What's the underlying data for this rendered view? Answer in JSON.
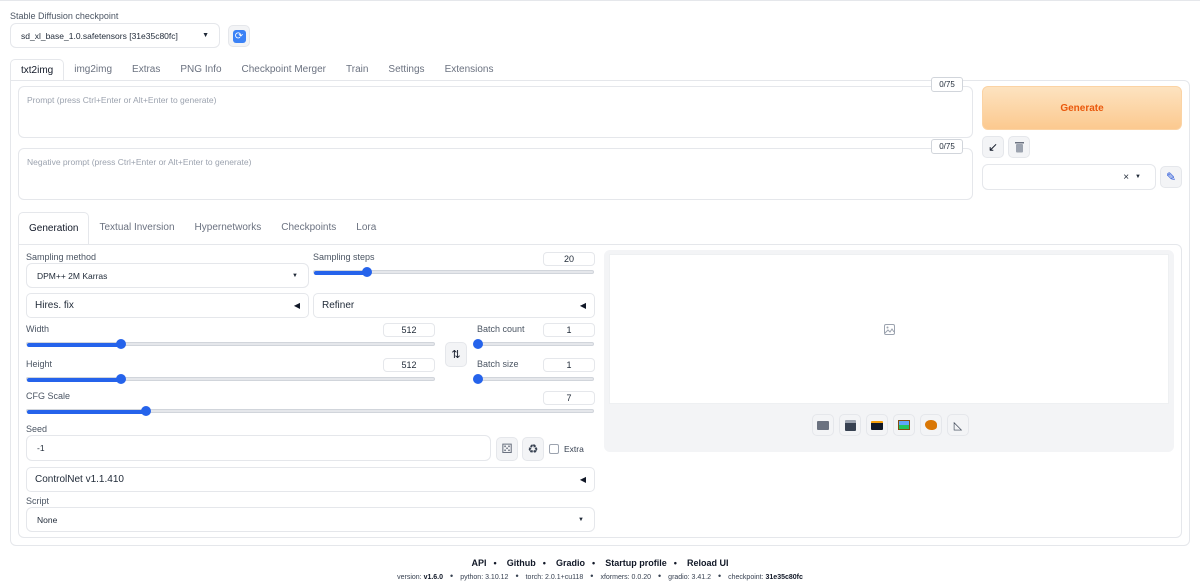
{
  "checkpoint": {
    "label": "Stable Diffusion checkpoint",
    "value": "sd_xl_base_1.0.safetensors [31e35c80fc]"
  },
  "tabs": [
    "txt2img",
    "img2img",
    "Extras",
    "PNG Info",
    "Checkpoint Merger",
    "Train",
    "Settings",
    "Extensions"
  ],
  "prompt": {
    "placeholder": "Prompt (press Ctrl+Enter or Alt+Enter to generate)",
    "counter": "0/75"
  },
  "negative_prompt": {
    "placeholder": "Negative prompt (press Ctrl+Enter or Alt+Enter to generate)",
    "counter": "0/75"
  },
  "generate_label": "Generate",
  "style_clear": "×",
  "subtabs": [
    "Generation",
    "Textual Inversion",
    "Hypernetworks",
    "Checkpoints",
    "Lora"
  ],
  "sampling_method": {
    "label": "Sampling method",
    "value": "DPM++ 2M Karras"
  },
  "sampling_steps": {
    "label": "Sampling steps",
    "value": "20",
    "fraction": 0.19
  },
  "hires_fix": "Hires. fix",
  "refiner": "Refiner",
  "width": {
    "label": "Width",
    "value": "512",
    "fraction": 0.23
  },
  "height": {
    "label": "Height",
    "value": "512",
    "fraction": 0.23
  },
  "batch_count": {
    "label": "Batch count",
    "value": "1",
    "fraction": 0.0
  },
  "batch_size": {
    "label": "Batch size",
    "value": "1",
    "fraction": 0.0
  },
  "cfg_scale": {
    "label": "CFG Scale",
    "value": "7",
    "fraction": 0.21
  },
  "seed": {
    "label": "Seed",
    "value": "-1",
    "extra_label": "Extra"
  },
  "controlnet": "ControlNet v1.1.410",
  "script": {
    "label": "Script",
    "value": "None"
  },
  "footer": {
    "links": [
      "API",
      "Github",
      "Gradio",
      "Startup profile",
      "Reload UI"
    ],
    "version_k": "version:",
    "version_v": "v1.6.0",
    "python": "python: 3.10.12",
    "torch": "torch: 2.0.1+cu118",
    "xformers": "xformers: 0.0.20",
    "gradio": "gradio: 3.41.2",
    "checkpoint_k": "checkpoint:",
    "checkpoint_v": "31e35c80fc"
  },
  "colors": {
    "accent": "#2563eb",
    "generate_bg": "#fdd7a8",
    "generate_text": "#ea580c"
  }
}
